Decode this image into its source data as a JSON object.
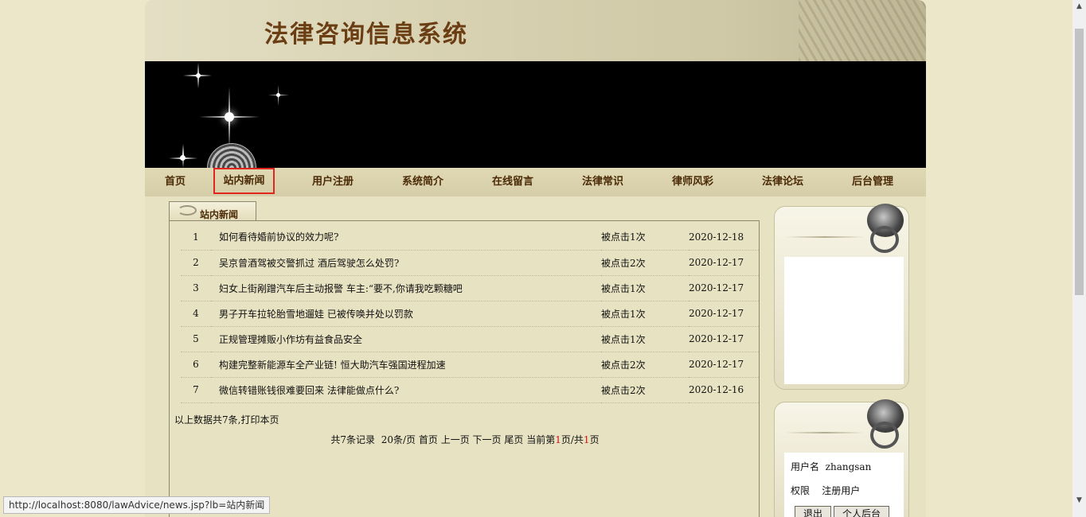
{
  "site": {
    "title": "法律咨询信息系统"
  },
  "nav": [
    {
      "label": "首页"
    },
    {
      "label": "站内新闻",
      "active": true
    },
    {
      "label": "用户注册"
    },
    {
      "label": "系统简介"
    },
    {
      "label": "在线留言"
    },
    {
      "label": "法律常识"
    },
    {
      "label": "律师风彩"
    },
    {
      "label": "法律论坛"
    },
    {
      "label": "后台管理"
    }
  ],
  "news": {
    "tab_label": "站内新闻",
    "rows": [
      {
        "num": "1",
        "title": "如何看待婚前协议的效力呢?",
        "clicks": "被点击1次",
        "date": "2020-12-18"
      },
      {
        "num": "2",
        "title": "吴京曾酒驾被交警抓过 酒后驾驶怎么处罚?",
        "clicks": "被点击2次",
        "date": "2020-12-17"
      },
      {
        "num": "3",
        "title": "妇女上街剐蹭汽车后主动报警 车主:“要不,你请我吃颗糖吧",
        "clicks": "被点击1次",
        "date": "2020-12-17"
      },
      {
        "num": "4",
        "title": "男子开车拉轮胎雪地遛娃 已被传唤并处以罚款",
        "clicks": "被点击1次",
        "date": "2020-12-17"
      },
      {
        "num": "5",
        "title": "正规管理摊贩小作坊有益食品安全",
        "clicks": "被点击1次",
        "date": "2020-12-17"
      },
      {
        "num": "6",
        "title": "构建完整新能源车全产业链! 恒大助汽车强国进程加速",
        "clicks": "被点击2次",
        "date": "2020-12-17"
      },
      {
        "num": "7",
        "title": "微信转错账钱很难要回来 法律能做点什么?",
        "clicks": "被点击2次",
        "date": "2020-12-16"
      }
    ],
    "summary": "以上数据共7条,打印本页",
    "pager": {
      "total": "共7条记录",
      "per_page": "20条/页",
      "first": "首页",
      "prev": "上一页",
      "next": "下一页",
      "last": "尾页",
      "current_prefix": "当前第",
      "current_page": "1",
      "current_mid": "页/共",
      "total_pages": "1",
      "current_suffix": "页"
    }
  },
  "user": {
    "username_label": "用户名",
    "username": "zhangsan",
    "role_label": "权限",
    "role": "注册用户",
    "logout_label": "退出",
    "personal_label": "个人后台"
  },
  "status_url": "http://localhost:8080/lawAdvice/news.jsp?lb=站内新闻",
  "colors": {
    "title": "#6b3d12",
    "nav_text": "#4b2a06",
    "active_outline": "#e0261f",
    "page_number": "#d01010"
  }
}
